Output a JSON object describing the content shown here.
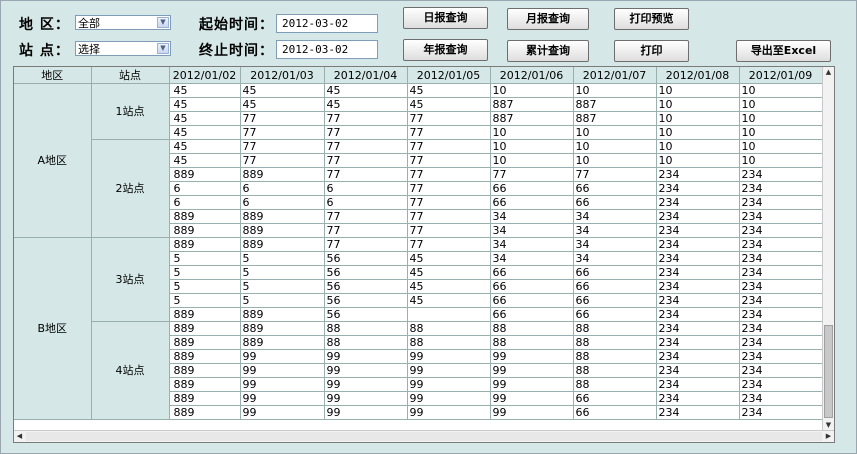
{
  "filters": {
    "region_label": "地  区：",
    "region_value": "全部",
    "station_label": "站  点：",
    "station_value": "选择",
    "start_label": "起始时间：",
    "start_value": "2012-03-02",
    "end_label": "终止时间：",
    "end_value": "2012-03-02"
  },
  "buttons": {
    "daily": "日报查询",
    "monthly": "月报查询",
    "print_preview": "打印预览",
    "yearly": "年报查询",
    "cumulative": "累计查询",
    "print": "打印",
    "export": "导出至Excel"
  },
  "grid": {
    "headers": [
      "地区",
      "站点",
      "2012/01/02",
      "2012/01/03",
      "2012/01/04",
      "2012/01/05",
      "2012/01/06",
      "2012/01/07",
      "2012/01/08",
      "2012/01/09"
    ],
    "regions": [
      {
        "name": "A地区",
        "stations": [
          {
            "name": "1站点",
            "rows": [
              [
                "45",
                "45",
                "45",
                "45",
                "10",
                "10",
                "10",
                "10"
              ],
              [
                "45",
                "45",
                "45",
                "45",
                "887",
                "887",
                "10",
                "10"
              ],
              [
                "45",
                "77",
                "77",
                "77",
                "887",
                "887",
                "10",
                "10"
              ],
              [
                "45",
                "77",
                "77",
                "77",
                "10",
                "10",
                "10",
                "10"
              ]
            ]
          },
          {
            "name": "2站点",
            "rows": [
              [
                "45",
                "77",
                "77",
                "77",
                "10",
                "10",
                "10",
                "10"
              ],
              [
                "45",
                "77",
                "77",
                "77",
                "10",
                "10",
                "10",
                "10"
              ],
              [
                "889",
                "889",
                "77",
                "77",
                "77",
                "77",
                "234",
                "234"
              ],
              [
                "6",
                "6",
                "6",
                "77",
                "66",
                "66",
                "234",
                "234"
              ],
              [
                "6",
                "6",
                "6",
                "77",
                "66",
                "66",
                "234",
                "234"
              ],
              [
                "889",
                "889",
                "77",
                "77",
                "34",
                "34",
                "234",
                "234"
              ],
              [
                "889",
                "889",
                "77",
                "77",
                "34",
                "34",
                "234",
                "234"
              ]
            ]
          }
        ]
      },
      {
        "name": "B地区",
        "stations": [
          {
            "name": "3站点",
            "rows": [
              [
                "889",
                "889",
                "77",
                "77",
                "34",
                "34",
                "234",
                "234"
              ],
              [
                "5",
                "5",
                "56",
                "45",
                "34",
                "34",
                "234",
                "234"
              ],
              [
                "5",
                "5",
                "56",
                "45",
                "66",
                "66",
                "234",
                "234"
              ],
              [
                "5",
                "5",
                "56",
                "45",
                "66",
                "66",
                "234",
                "234"
              ],
              [
                "5",
                "5",
                "56",
                "45",
                "66",
                "66",
                "234",
                "234"
              ],
              [
                "889",
                "889",
                "56",
                "",
                "66",
                "66",
                "234",
                "234"
              ]
            ]
          },
          {
            "name": "4站点",
            "rows": [
              [
                "889",
                "889",
                "88",
                "88",
                "88",
                "88",
                "234",
                "234"
              ],
              [
                "889",
                "889",
                "88",
                "88",
                "88",
                "88",
                "234",
                "234"
              ],
              [
                "889",
                "99",
                "99",
                "99",
                "99",
                "88",
                "234",
                "234"
              ],
              [
                "889",
                "99",
                "99",
                "99",
                "99",
                "88",
                "234",
                "234"
              ],
              [
                "889",
                "99",
                "99",
                "99",
                "99",
                "88",
                "234",
                "234"
              ],
              [
                "889",
                "99",
                "99",
                "99",
                "99",
                "66",
                "234",
                "234"
              ],
              [
                "889",
                "99",
                "99",
                "99",
                "99",
                "66",
                "234",
                "234"
              ]
            ]
          }
        ]
      }
    ]
  },
  "icons": {
    "dropdown": "chevron-down-icon",
    "scroll_up": "arrow-up-icon",
    "scroll_down": "arrow-down-icon",
    "scroll_left": "arrow-left-icon",
    "scroll_right": "arrow-right-icon"
  },
  "colors": {
    "background": "#d5e8e7",
    "grid_line": "#9ab0ae"
  }
}
